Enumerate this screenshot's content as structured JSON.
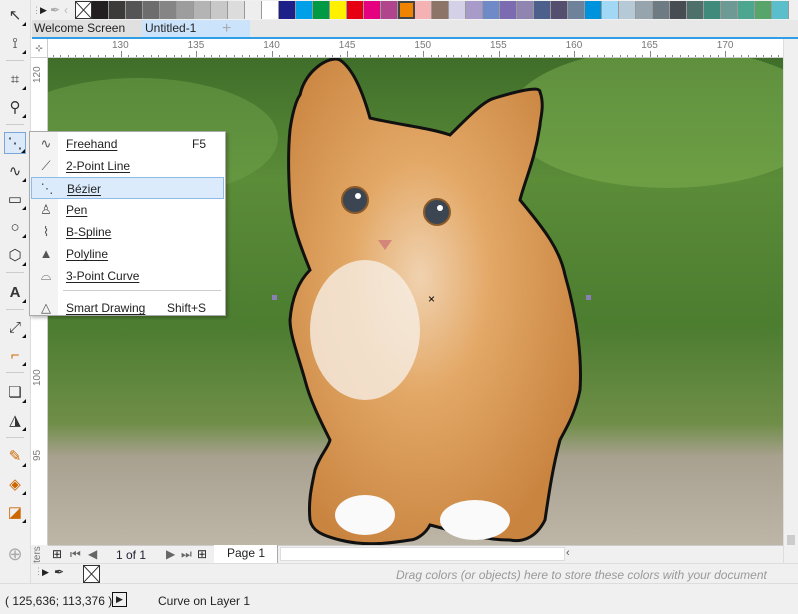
{
  "palette": {
    "colors": [
      "#231f20",
      "#3d3a3a",
      "#555555",
      "#6d6d6d",
      "#858585",
      "#9d9d9d",
      "#b4b4b4",
      "#c8c8c8",
      "#dcdcdc",
      "#eeeeee",
      "#ffffff",
      "#1d2088",
      "#00a0e9",
      "#009a44",
      "#fff100",
      "#e60012",
      "#e4007f",
      "#b0458e",
      "#f08300",
      "#f5b2b2",
      "#8c7468",
      "#d3d0e8",
      "#a89bc9",
      "#6f8ac6",
      "#7c6bb1",
      "#8f85b0",
      "#4d5f8b",
      "#554e6e",
      "#6f829b",
      "#0093dd",
      "#a1d8f6",
      "#b5cad6",
      "#96a5ad",
      "#6e7b83",
      "#474d53",
      "#4e706a",
      "#3f8a7a",
      "#6d9a94",
      "#4da690",
      "#58a56b",
      "#5bbfcb"
    ],
    "selected": "#f08300"
  },
  "tabs": [
    {
      "label": "Welcome Screen"
    },
    {
      "label": "Untitled-1",
      "active": true
    }
  ],
  "ruler": {
    "h_labels": [
      "130",
      "135",
      "140",
      "145",
      "150",
      "155",
      "160",
      "165",
      "170"
    ],
    "v_labels": [
      "120",
      "100",
      "95"
    ],
    "unit": "millimeters"
  },
  "flyout": {
    "items": [
      {
        "icon": "freehand-icon",
        "glyph": "∿",
        "label": "Freehand",
        "shortcut": "F5"
      },
      {
        "icon": "two-point-line-icon",
        "glyph": "⟋",
        "label": "2-Point Line",
        "shortcut": ""
      },
      {
        "icon": "bezier-icon",
        "glyph": "⋱",
        "label": "Bézier",
        "shortcut": "",
        "highlighted": true
      },
      {
        "icon": "pen-icon",
        "glyph": "♙",
        "label": "Pen",
        "shortcut": ""
      },
      {
        "icon": "b-spline-icon",
        "glyph": "⌇",
        "label": "B-Spline",
        "shortcut": ""
      },
      {
        "icon": "polyline-icon",
        "glyph": "▲",
        "label": "Polyline",
        "shortcut": ""
      },
      {
        "icon": "three-point-curve-icon",
        "glyph": "⌓",
        "label": "3-Point Curve",
        "shortcut": ""
      },
      {
        "icon": "smart-drawing-icon",
        "glyph": "△",
        "label": "Smart Drawing",
        "shortcut": "Shift+S"
      }
    ]
  },
  "nav": {
    "page_count": "1 of 1",
    "page_tab": "Page 1"
  },
  "document_palette": {
    "hint": "Drag colors (or objects) here to store these colors with your document"
  },
  "status": {
    "coords": "( 125,636; 113,376 )",
    "object_info": "Curve on Layer 1"
  }
}
